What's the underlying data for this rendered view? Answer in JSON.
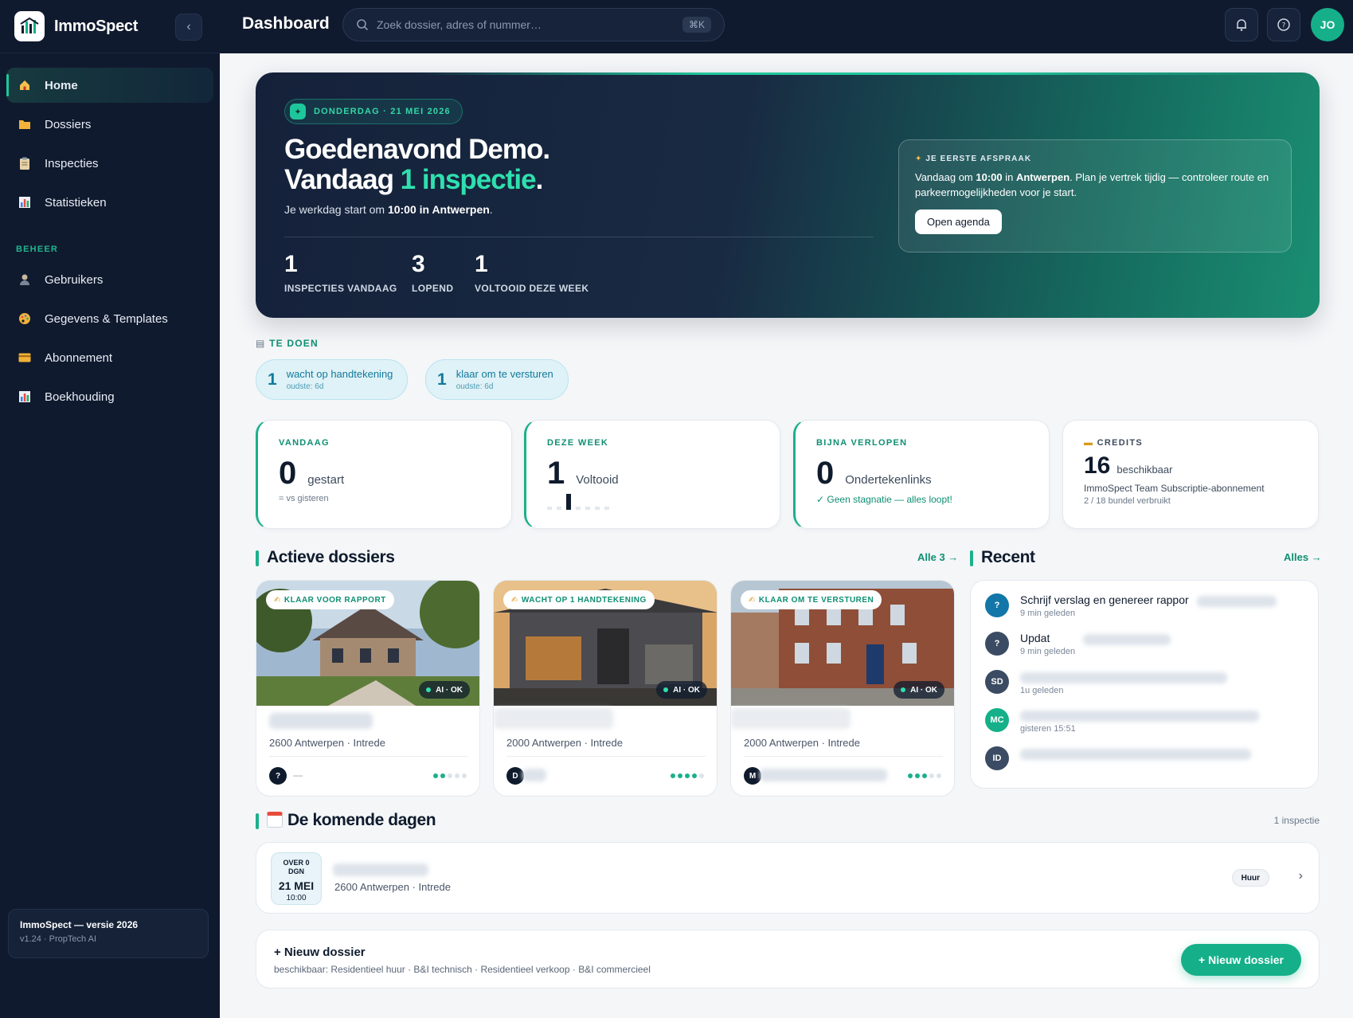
{
  "app": {
    "name": "ImmoSpect",
    "page_title": "Dashboard",
    "version_title": "ImmoSpect — versie 2026",
    "version_sub": "v1.24 · PropTech AI"
  },
  "search": {
    "placeholder": "Zoek dossier, adres of nummer…",
    "shortcut": "⌘K"
  },
  "user": {
    "initials": "JO"
  },
  "sidebar": {
    "items": [
      {
        "label": "Home",
        "icon": "home-icon",
        "active": true
      },
      {
        "label": "Dossiers",
        "icon": "folder-icon"
      },
      {
        "label": "Inspecties",
        "icon": "clipboard-icon"
      },
      {
        "label": "Statistieken",
        "icon": "chart-icon"
      }
    ],
    "section_label": "BEHEER",
    "admin_items": [
      {
        "label": "Gebruikers",
        "icon": "user-icon"
      },
      {
        "label": "Gegevens & Templates",
        "icon": "palette-icon"
      },
      {
        "label": "Abonnement",
        "icon": "credit-card-icon"
      },
      {
        "label": "Boekhouding",
        "icon": "chart-icon"
      }
    ]
  },
  "hero": {
    "date": "DONDERDAG · 21 MEI 2026",
    "title_line1": "Goedenavond Demo.",
    "title_line2_pre": "Vandaag ",
    "title_line2_accent": "1 inspectie",
    "title_line2_post": ".",
    "sub_pre": "Je werkdag start om ",
    "sub_bold": "10:00 in Antwerpen",
    "sub_post": ".",
    "stats": [
      {
        "value": "1",
        "label": "INSPECTIES VANDAAG"
      },
      {
        "value": "3",
        "label": "LOPEND"
      },
      {
        "value": "1",
        "label": "VOLTOOID DEZE WEEK"
      }
    ],
    "appointment": {
      "label": "JE EERSTE AFSPRAAK",
      "text_pre": "Vandaag om ",
      "text_bold1": "10:00",
      "text_mid": " in ",
      "text_bold2": "Antwerpen",
      "text_post": ". Plan je vertrek tijdig — controleer route en parkeermogelijkheden voor je start.",
      "button": "Open agenda"
    }
  },
  "todo": {
    "label": "TE DOEN",
    "items": [
      {
        "count": "1",
        "text": "wacht op handtekening",
        "sub": "oudste: 6d"
      },
      {
        "count": "1",
        "text": "klaar om te versturen",
        "sub": "oudste: 6d"
      }
    ]
  },
  "stats": {
    "today": {
      "label": "VANDAAG",
      "value": "0",
      "unit": "gestart",
      "foot": "= vs gisteren"
    },
    "week": {
      "label": "DEZE WEEK",
      "value": "1",
      "unit": "Voltooid"
    },
    "expiring": {
      "label": "BIJNA VERLOPEN",
      "value": "0",
      "unit": "Ondertekenlinks",
      "foot": "✓ Geen stagnatie — alles loopt!"
    },
    "credits": {
      "label": "CREDITS",
      "value": "16",
      "unit": "beschikbaar",
      "plan": "ImmoSpect Team Subscriptie-abonnement",
      "usage": "2 / 18 bundel verbruikt"
    }
  },
  "active_dossiers": {
    "title": "Actieve dossiers",
    "link": "Alle 3 →",
    "cards": [
      {
        "badge": "KLAAR VOOR RAPPORT",
        "ai": "AI · OK",
        "location": "2600 Antwerpen · Intrede",
        "avatar": "?",
        "avatar_extra": "—",
        "progress_steps": 5,
        "progress_done": 2
      },
      {
        "badge": "WACHT OP 1 HANDTEKENING",
        "ai": "AI · OK",
        "location": "2000 Antwerpen · Intrede",
        "avatar": "D",
        "avatar_extra": "",
        "progress_steps": 5,
        "progress_done": 4
      },
      {
        "badge": "KLAAR OM TE VERSTUREN",
        "ai": "AI · OK",
        "location": "2000 Antwerpen · Intrede",
        "avatar": "M",
        "avatar_extra": "",
        "progress_steps": 5,
        "progress_done": 3
      }
    ]
  },
  "recent": {
    "title": "Recent",
    "link": "Alles →",
    "items": [
      {
        "initials": "?",
        "color": "#1277a8",
        "text": "Schrijf verslag en genereer rappor",
        "time": "9 min geleden"
      },
      {
        "initials": "?",
        "color": "#3b4b63",
        "text": "Updat",
        "time": "9 min geleden"
      },
      {
        "initials": "SD",
        "color": "#3b4b63",
        "text": "",
        "time": "1u geleden"
      },
      {
        "initials": "MC",
        "color": "#15b089",
        "text": "",
        "time": "gisteren 15:51"
      },
      {
        "initials": "ID",
        "color": "#3b4b63",
        "text": "",
        "time": ""
      }
    ]
  },
  "upcoming": {
    "title": "De komende dagen",
    "count": "1 inspectie",
    "item": {
      "over": "OVER 0 DGN",
      "date": "21 MEI",
      "time": "10:00",
      "location": "2600 Antwerpen · Intrede",
      "tag": "Huur"
    }
  },
  "new_dossier": {
    "title": "+ Nieuw dossier",
    "available": "beschikbaar: Residentieel huur · B&I technisch · Residentieel verkoop · B&I commercieel",
    "button": "+ Nieuw dossier"
  },
  "colors": {
    "accent": "#15b089",
    "navy": "#101a2e",
    "teal_text": "#0e8f73"
  }
}
